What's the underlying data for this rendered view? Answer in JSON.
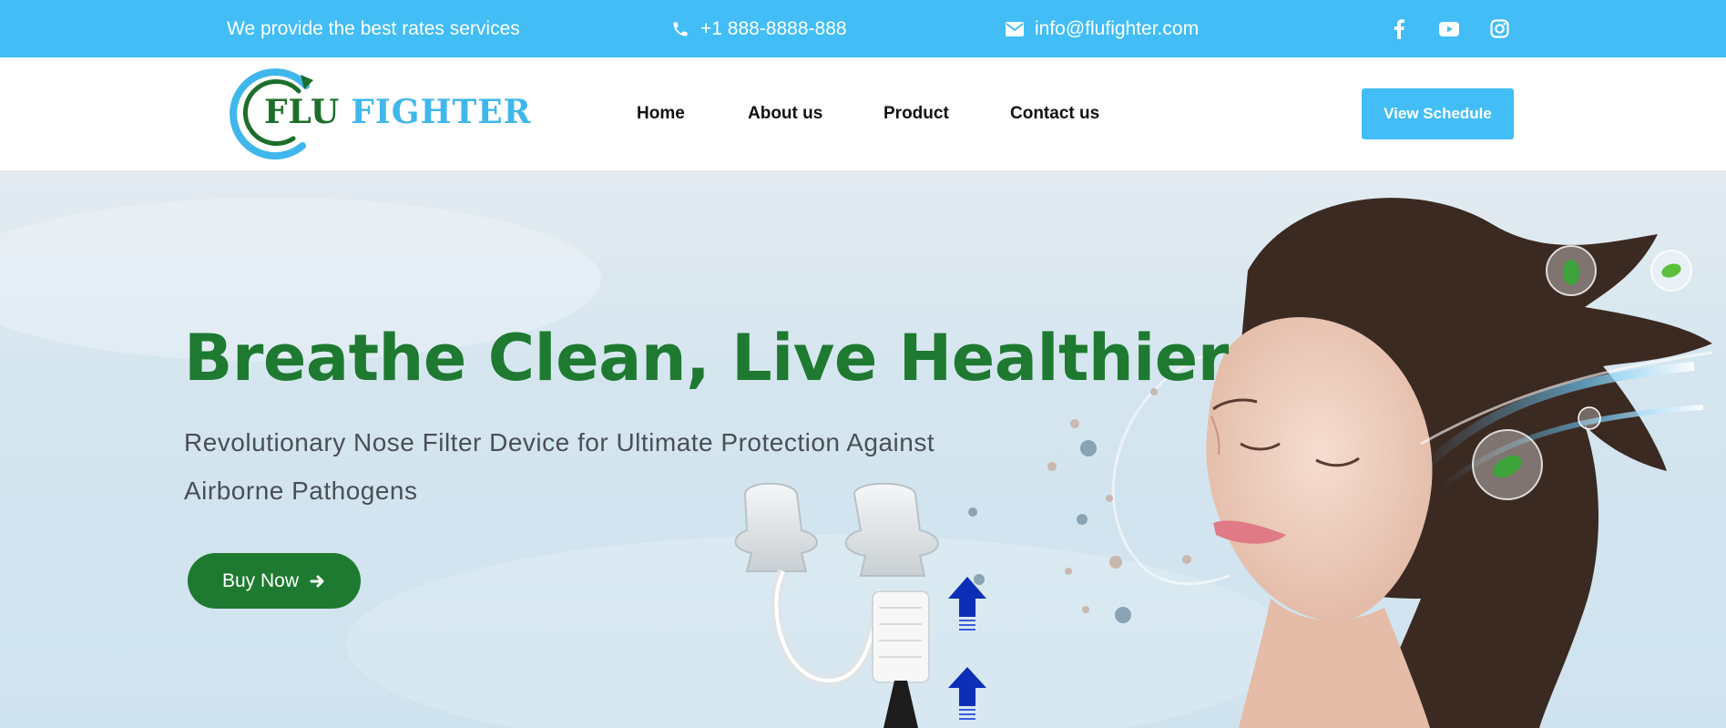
{
  "topbar": {
    "tagline": "We provide the best rates services",
    "phone": "+1 888-8888-888",
    "email": "info@flufighter.com",
    "social": [
      "facebook-icon",
      "youtube-icon",
      "instagram-icon"
    ]
  },
  "header": {
    "logo": {
      "word1": "FLU",
      "word2": "FIGHTER"
    },
    "nav": [
      "Home",
      "About us",
      "Product",
      "Contact us"
    ],
    "cta": "View Schedule"
  },
  "hero": {
    "title": "Breathe Clean, Live Healthier",
    "subtitle": "Revolutionary Nose Filter Device for Ultimate Protection Against Airborne Pathogens",
    "button": "Buy Now",
    "button_icon": "arrow-right-icon"
  },
  "colors": {
    "brand_blue": "#42bdf6",
    "brand_green": "#1e7a30",
    "text_dark": "#111111"
  }
}
